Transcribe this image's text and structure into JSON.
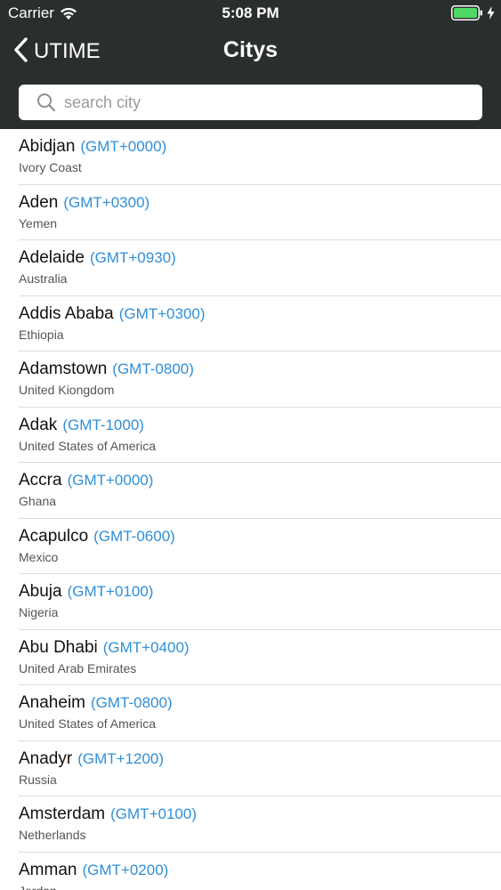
{
  "status_bar": {
    "carrier": "Carrier",
    "time": "5:08 PM",
    "wifi_icon": "wifi-icon",
    "battery_icon": "battery-icon",
    "charging_icon": "charging-bolt-icon"
  },
  "nav": {
    "back_label": "UTIME",
    "title": "Citys",
    "back_icon": "chevron-left-icon"
  },
  "search": {
    "placeholder": "search city",
    "value": "",
    "icon": "search-icon"
  },
  "colors": {
    "header_bg": "#2a2f2d",
    "gmt_blue": "#2f8fd8",
    "battery_green": "#4cd964"
  },
  "cities": [
    {
      "name": "Abidjan",
      "gmt": "(GMT+0000)",
      "country": "Ivory Coast"
    },
    {
      "name": "Aden",
      "gmt": "(GMT+0300)",
      "country": "Yemen"
    },
    {
      "name": "Adelaide",
      "gmt": "(GMT+0930)",
      "country": "Australia"
    },
    {
      "name": "Addis Ababa",
      "gmt": "(GMT+0300)",
      "country": "Ethiopia"
    },
    {
      "name": "Adamstown",
      "gmt": "(GMT-0800)",
      "country": "United Kiongdom"
    },
    {
      "name": "Adak",
      "gmt": "(GMT-1000)",
      "country": "United States of America"
    },
    {
      "name": "Accra",
      "gmt": "(GMT+0000)",
      "country": "Ghana"
    },
    {
      "name": "Acapulco",
      "gmt": "(GMT-0600)",
      "country": "Mexico"
    },
    {
      "name": "Abuja",
      "gmt": "(GMT+0100)",
      "country": "Nigeria"
    },
    {
      "name": "Abu Dhabi",
      "gmt": "(GMT+0400)",
      "country": "United Arab Emirates"
    },
    {
      "name": "Anaheim",
      "gmt": "(GMT-0800)",
      "country": "United States of America"
    },
    {
      "name": "Anadyr",
      "gmt": "(GMT+1200)",
      "country": "Russia"
    },
    {
      "name": "Amsterdam",
      "gmt": "(GMT+0100)",
      "country": "Netherlands"
    },
    {
      "name": "Amman",
      "gmt": "(GMT+0200)",
      "country": "Jordan"
    }
  ]
}
